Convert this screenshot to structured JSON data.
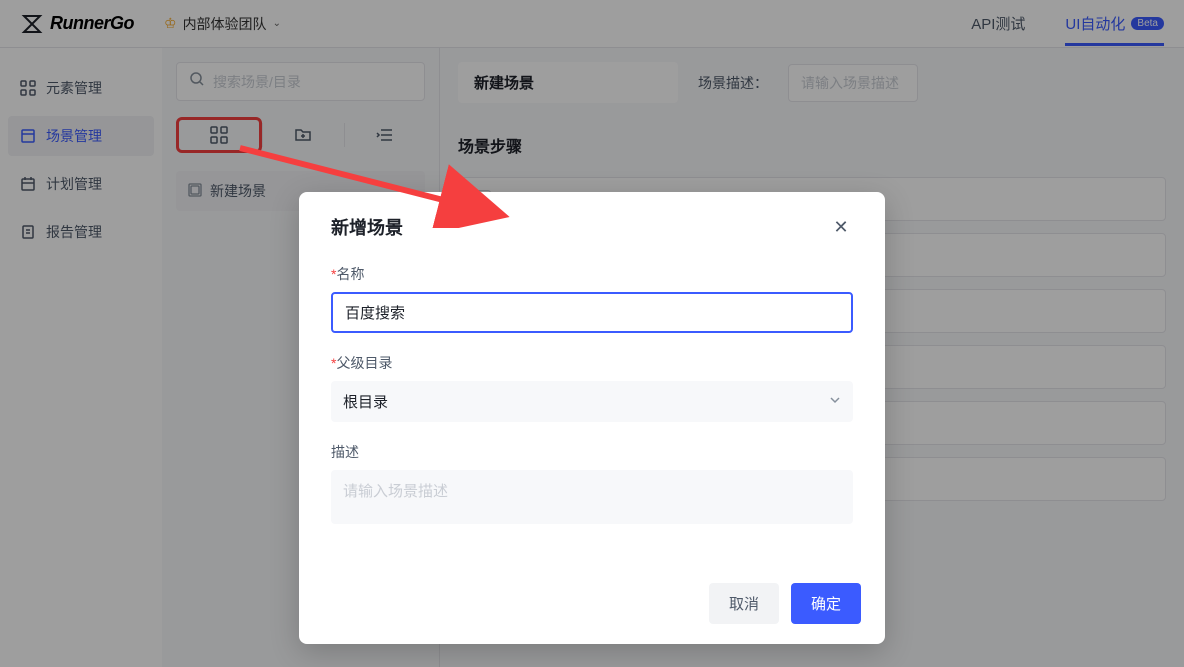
{
  "header": {
    "logo_text": "RunnerGo",
    "team_name": "内部体验团队",
    "nav": {
      "api_test": "API测试",
      "ui_auto": "UI自动化",
      "beta": "Beta"
    }
  },
  "sidebar": {
    "items": [
      {
        "label": "元素管理"
      },
      {
        "label": "场景管理"
      },
      {
        "label": "计划管理"
      },
      {
        "label": "报告管理"
      }
    ]
  },
  "left_panel": {
    "search_placeholder": "搜索场景/目录",
    "tree": {
      "new_scene": "新建场景"
    }
  },
  "main_panel": {
    "scene_title": "新建场景",
    "desc_label": "场景描述：",
    "desc_placeholder": "请输入场景描述",
    "steps_title": "场景步骤"
  },
  "modal": {
    "title": "新增场景",
    "name_label": "名称",
    "name_value": "百度搜索",
    "parent_label": "父级目录",
    "parent_value": "根目录",
    "desc_label": "描述",
    "desc_placeholder": "请输入场景描述",
    "cancel": "取消",
    "confirm": "确定"
  }
}
